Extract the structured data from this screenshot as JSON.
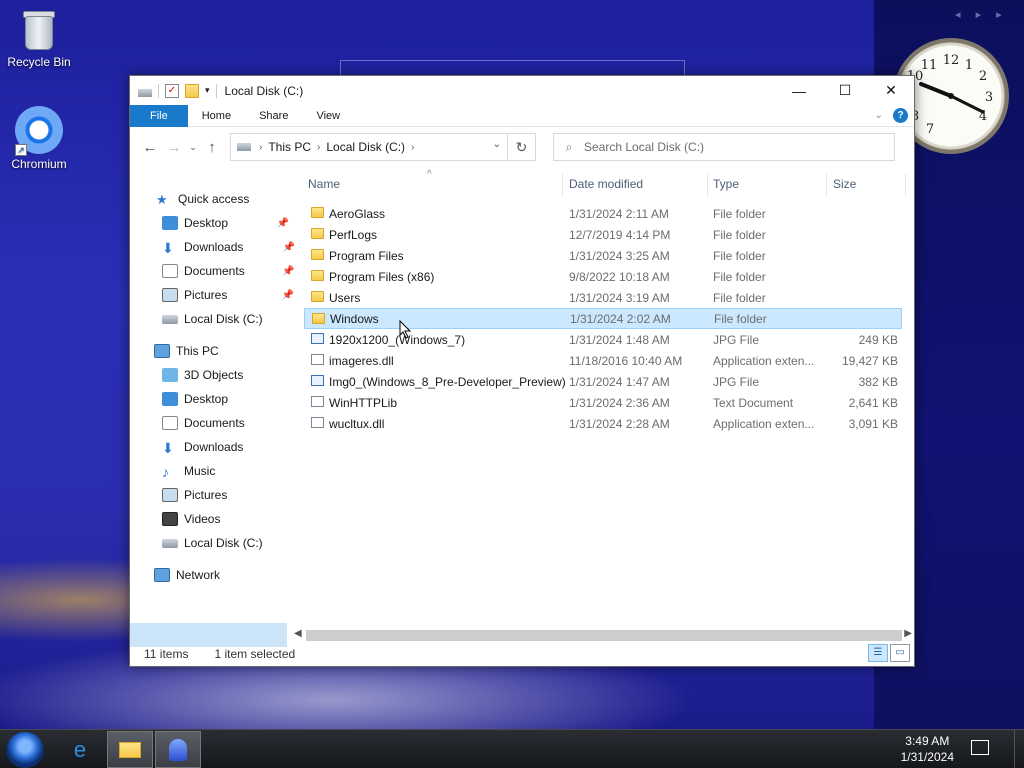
{
  "desktop": {
    "icons": [
      {
        "label": "Recycle Bin",
        "icon": "recycle-bin-icon"
      },
      {
        "label": "Chromium",
        "icon": "chromium-icon"
      }
    ]
  },
  "window": {
    "title": "Local Disk (C:)",
    "controls": {
      "minimize": "—",
      "maximize": "☐",
      "close": "✕"
    },
    "ribbon": {
      "file": "File",
      "home": "Home",
      "share": "Share",
      "view": "View",
      "help": "?"
    },
    "address": {
      "crumbs": [
        "This PC",
        "Local Disk (C:)"
      ]
    },
    "search": {
      "placeholder": "Search Local Disk (C:)"
    },
    "nav": {
      "quick_access": "Quick access",
      "qa_items": [
        "Desktop",
        "Downloads",
        "Documents",
        "Pictures",
        "Local Disk (C:)"
      ],
      "this_pc": "This PC",
      "pc_items": [
        "3D Objects",
        "Desktop",
        "Documents",
        "Downloads",
        "Music",
        "Pictures",
        "Videos",
        "Local Disk (C:)"
      ],
      "network": "Network"
    },
    "columns": {
      "name": "Name",
      "date": "Date modified",
      "type": "Type",
      "size": "Size"
    },
    "files": [
      {
        "name": "AeroGlass",
        "date": "1/31/2024 2:11 AM",
        "type": "File folder",
        "size": "",
        "kind": "folder"
      },
      {
        "name": "PerfLogs",
        "date": "12/7/2019 4:14 PM",
        "type": "File folder",
        "size": "",
        "kind": "folder"
      },
      {
        "name": "Program Files",
        "date": "1/31/2024 3:25 AM",
        "type": "File folder",
        "size": "",
        "kind": "folder"
      },
      {
        "name": "Program Files (x86)",
        "date": "9/8/2022 10:18 AM",
        "type": "File folder",
        "size": "",
        "kind": "folder"
      },
      {
        "name": "Users",
        "date": "1/31/2024 3:19 AM",
        "type": "File folder",
        "size": "",
        "kind": "folder"
      },
      {
        "name": "Windows",
        "date": "1/31/2024 2:02 AM",
        "type": "File folder",
        "size": "",
        "kind": "folder",
        "selected": true
      },
      {
        "name": "1920x1200_(Windows_7)",
        "date": "1/31/2024 1:48 AM",
        "type": "JPG File",
        "size": "249 KB",
        "kind": "jpg"
      },
      {
        "name": "imageres.dll",
        "date": "11/18/2016 10:40 AM",
        "type": "Application exten...",
        "size": "19,427 KB",
        "kind": "file"
      },
      {
        "name": "Img0_(Windows_8_Pre-Developer_Preview)",
        "date": "1/31/2024 1:47 AM",
        "type": "JPG File",
        "size": "382 KB",
        "kind": "jpg"
      },
      {
        "name": "WinHTTPLib",
        "date": "1/31/2024 2:36 AM",
        "type": "Text Document",
        "size": "2,641 KB",
        "kind": "file"
      },
      {
        "name": "wucltux.dll",
        "date": "1/31/2024 2:28 AM",
        "type": "Application exten...",
        "size": "3,091 KB",
        "kind": "file"
      }
    ],
    "status": {
      "count": "11 items",
      "selection": "1 item selected"
    }
  },
  "taskbar": {
    "time": "3:49 AM",
    "date": "1/31/2024"
  },
  "colors": {
    "accent": "#1979ca",
    "selection": "#cce8ff",
    "desktop": "#2a2fb5"
  }
}
